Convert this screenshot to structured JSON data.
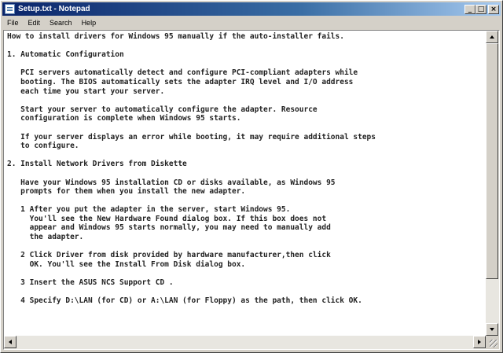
{
  "window": {
    "title": "Setup.txt - Notepad",
    "app_icon": "notepad-icon",
    "buttons": {
      "minimize": "_",
      "maximize": "□",
      "close": "×"
    }
  },
  "menu": [
    "File",
    "Edit",
    "Search",
    "Help"
  ],
  "document": {
    "lines": [
      "How to install drivers for Windows 95 manually if the auto-installer fails.",
      "",
      "1. Automatic Configuration",
      "",
      "   PCI servers automatically detect and configure PCI-compliant adapters while",
      "   booting. The BIOS automatically sets the adapter IRQ level and I/O address",
      "   each time you start your server.",
      "",
      "   Start your server to automatically configure the adapter. Resource",
      "   configuration is complete when Windows 95 starts.",
      "",
      "   If your server displays an error while booting, it may require additional steps",
      "   to configure.",
      "",
      "2. Install Network Drivers from Diskette",
      "",
      "   Have your Windows 95 installation CD or disks available, as Windows 95",
      "   prompts for them when you install the new adapter.",
      "",
      "   1 After you put the adapter in the server, start Windows 95.",
      "     You'll see the New Hardware Found dialog box. If this box does not",
      "     appear and Windows 95 starts normally, you may need to manually add",
      "     the adapter.",
      "",
      "   2 Click Driver from disk provided by hardware manufacturer,then click",
      "     OK. You'll see the Install From Disk dialog box.",
      "",
      "   3 Insert the ASUS NCS Support CD .",
      "",
      "   4 Specify D:\\LAN (for CD) or A:\\LAN (for Floppy) as the path, then click OK.",
      ""
    ]
  },
  "scrollbars": {
    "up_icon": "arrow-up-icon",
    "down_icon": "arrow-down-icon",
    "left_icon": "arrow-left-icon",
    "right_icon": "arrow-right-icon",
    "vertical_position": 0.0
  }
}
